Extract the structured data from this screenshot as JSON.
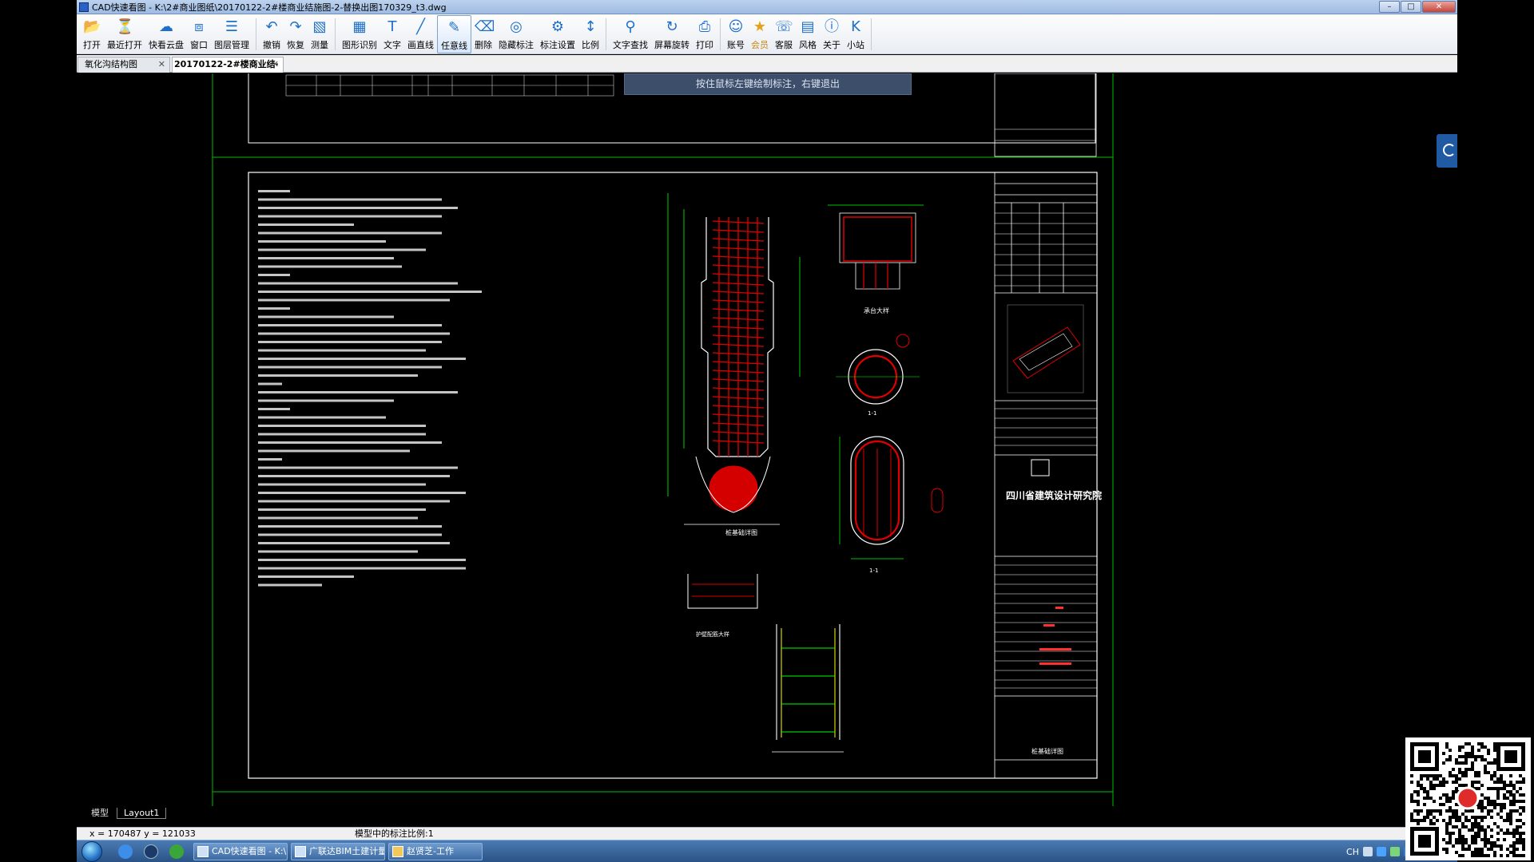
{
  "window": {
    "title": "CAD快速看图 - K:\\2#商业图纸\\20170122-2#楼商业结施图-2-替换出图170329_t3.dwg"
  },
  "toolbar": {
    "items": [
      {
        "label": "打开",
        "icon": "folder-open-icon"
      },
      {
        "label": "最近打开",
        "icon": "recent-icon"
      },
      {
        "label": "快看云盘",
        "icon": "cloud-icon"
      },
      {
        "label": "窗口",
        "icon": "window-icon"
      },
      {
        "label": "图层管理",
        "icon": "layers-icon"
      },
      {
        "label": "撤销",
        "icon": "undo-icon"
      },
      {
        "label": "恢复",
        "icon": "redo-icon"
      },
      {
        "label": "测量",
        "icon": "measure-icon"
      },
      {
        "label": "图形识别",
        "icon": "shape-recognition-icon"
      },
      {
        "label": "文字",
        "icon": "text-icon"
      },
      {
        "label": "画直线",
        "icon": "line-icon"
      },
      {
        "label": "任意线",
        "icon": "freehand-icon"
      },
      {
        "label": "删除",
        "icon": "eraser-icon"
      },
      {
        "label": "隐藏标注",
        "icon": "hide-annotation-icon"
      },
      {
        "label": "标注设置",
        "icon": "annotation-settings-icon"
      },
      {
        "label": "比例",
        "icon": "scale-icon"
      },
      {
        "label": "文字查找",
        "icon": "text-search-icon"
      },
      {
        "label": "屏幕旋转",
        "icon": "rotate-screen-icon"
      },
      {
        "label": "打印",
        "icon": "print-icon"
      },
      {
        "label": "账号",
        "icon": "account-icon"
      },
      {
        "label": "会员",
        "icon": "vip-icon"
      },
      {
        "label": "客服",
        "icon": "headset-icon"
      },
      {
        "label": "风格",
        "icon": "style-icon"
      },
      {
        "label": "关于",
        "icon": "info-icon"
      },
      {
        "label": "小站",
        "icon": "k-site-icon"
      }
    ],
    "active_index": 11
  },
  "tabs": [
    {
      "label": "氧化沟结构图"
    },
    {
      "label": "20170122-2#楼商业结·"
    }
  ],
  "canvas": {
    "hint": "按住鼠标左键绘制标注，右键退出",
    "drawing": {
      "design_institute": "四川省建筑设计研究院",
      "sheet_title": "桩基础详图",
      "detail_labels": [
        "桩基础详图",
        "承台大样",
        "护壁配筋大样"
      ],
      "section_labels": [
        "1-1",
        "1-1"
      ]
    }
  },
  "layout_tabs": [
    "模型",
    "Layout1"
  ],
  "status": {
    "coords": "x = 170487  y = 121033",
    "annotation_scale": "模型中的标注比例:1"
  },
  "taskbar": {
    "tasks": [
      {
        "label": "CAD快速看图 - K:\\2..."
      },
      {
        "label": "广联达BIM土建计量..."
      },
      {
        "label": "赵贤芝-工作"
      }
    ],
    "ime": "CH"
  },
  "colors": {
    "drawing_frame": "#00d000",
    "drawing_white": "#ffffff",
    "rebar_red": "#e00000",
    "dimension_green": "#00ff00",
    "annotation_yellow": "#ffff00"
  }
}
